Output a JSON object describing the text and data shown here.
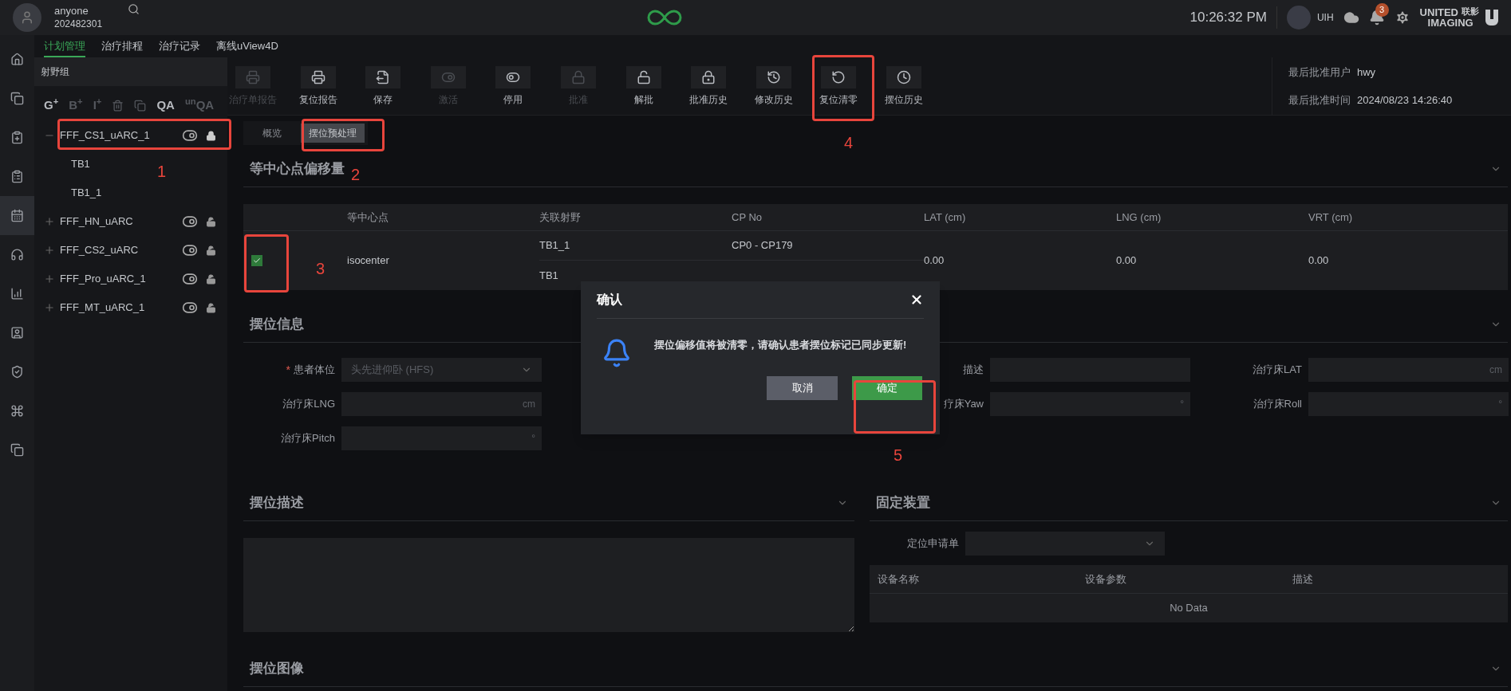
{
  "header": {
    "user_name": "anyone",
    "user_id": "202482301",
    "time": "10:26:32 PM",
    "account": "UIH",
    "notifications": "3",
    "brand": {
      "line1": "UNITED",
      "cn": "联影",
      "line2": "IMAGING"
    }
  },
  "rail": [
    {
      "selected": false
    },
    {
      "selected": false
    },
    {
      "selected": false
    },
    {
      "selected": false
    },
    {
      "selected": true
    },
    {
      "selected": false
    },
    {
      "selected": false
    },
    {
      "selected": false
    },
    {
      "selected": false
    },
    {
      "selected": false
    },
    {
      "selected": false
    }
  ],
  "nav_tabs": [
    {
      "label": "计划管理",
      "selected": true
    },
    {
      "label": "治疗排程",
      "selected": false
    },
    {
      "label": "治疗记录",
      "selected": false
    },
    {
      "label": "离线uView4D",
      "selected": false
    }
  ],
  "field_groups": {
    "title": "射野组",
    "tools": [
      {
        "kind": "text",
        "label": "G$^{+}$",
        "disabled": false
      },
      {
        "kind": "text",
        "label": "B$^{+}$",
        "disabled": true
      },
      {
        "kind": "text",
        "label": "I$^{+}$",
        "disabled": true
      },
      {
        "kind": "delete",
        "disabled": true
      },
      {
        "kind": "copy",
        "disabled": true
      },
      {
        "kind": "text",
        "label": "QA",
        "disabled": false
      },
      {
        "kind": "text",
        "label": "$^{un}$QA",
        "disabled": true
      }
    ],
    "tree": [
      {
        "label": "FFF_CS1_uARC_1",
        "expanded": true,
        "locked": true,
        "children": [
          {
            "label": "TB1"
          },
          {
            "label": "TB1_1"
          }
        ]
      },
      {
        "label": "FFF_HN_uARC",
        "expanded": false,
        "locked": false
      },
      {
        "label": "FFF_CS2_uARC",
        "expanded": false,
        "locked": false
      },
      {
        "label": "FFF_Pro_uARC_1",
        "expanded": false,
        "locked": false
      },
      {
        "label": "FFF_MT_uARC_1",
        "expanded": false,
        "locked": false
      }
    ]
  },
  "toolbar": [
    {
      "label": "治疗单报告",
      "disabled": true
    },
    {
      "label": "复位报告",
      "disabled": false
    },
    {
      "label": "保存",
      "disabled": false
    },
    {
      "label": "激活",
      "disabled": true
    },
    {
      "label": "停用",
      "disabled": false
    },
    {
      "label": "批准",
      "disabled": true
    },
    {
      "label": "解批",
      "disabled": false
    },
    {
      "label": "批准历史",
      "disabled": false
    },
    {
      "label": "修改历史",
      "disabled": false
    },
    {
      "label": "复位清零",
      "disabled": false
    },
    {
      "label": "摆位历史",
      "disabled": false
    }
  ],
  "approval": [
    {
      "label": "最后批准用户",
      "value": "hwy"
    },
    {
      "label": "最后批准时间",
      "value": "2024/08/23 14:26:40"
    }
  ],
  "sub_tabs": [
    {
      "label": "概览",
      "selected": false
    },
    {
      "label": "摆位预处理",
      "selected": true
    }
  ],
  "offset": {
    "title": "等中心点偏移量",
    "columns": [
      "等中心点",
      "关联射野",
      "CP No",
      "LAT (cm)",
      "LNG (cm)",
      "VRT (cm)"
    ],
    "rows": [
      {
        "checked": true,
        "isocenter": "isocenter",
        "fields": [
          {
            "name": "TB1_1",
            "cp": "CP0 - CP179"
          },
          {
            "name": "TB1"
          }
        ],
        "lat": "0.00",
        "lng": "0.00",
        "vrt": "0.00"
      }
    ]
  },
  "setup_info": {
    "title": "摆位信息",
    "rows": [
      [
        {
          "kind": "select",
          "label": "患者体位",
          "required_mark": "*",
          "value": "头先进仰卧 (HFS)",
          "disabled": true
        },
        {
          "kind": "input",
          "label": "描述"
        },
        {
          "kind": "input",
          "label": "治疗床LAT",
          "unit": "cm"
        }
      ],
      [
        {
          "kind": "input",
          "label": "治疗床LNG",
          "unit": "cm"
        },
        {
          "kind": "input",
          "label": "疗床Yaw",
          "unit": "°"
        },
        {
          "kind": "input",
          "label": "治疗床Roll",
          "unit": "°"
        }
      ],
      [
        {
          "kind": "input",
          "label": "治疗床Pitch",
          "unit": "°"
        }
      ]
    ]
  },
  "setup_desc": {
    "title": "摆位描述"
  },
  "fixation": {
    "title": "固定装置",
    "request_label": "定位申请单",
    "columns": [
      "设备名称",
      "设备参数",
      "描述"
    ],
    "empty": "No Data"
  },
  "setup_image": {
    "title": "摆位图像"
  },
  "dialog": {
    "title": "确认",
    "message": "摆位偏移值将被清零，请确认患者摆位标记已同步更新!",
    "cancel": "取消",
    "ok": "确定"
  },
  "annotations": [
    {
      "label": "1"
    },
    {
      "label": "2"
    },
    {
      "label": "3"
    },
    {
      "label": "4"
    },
    {
      "label": "5"
    }
  ]
}
